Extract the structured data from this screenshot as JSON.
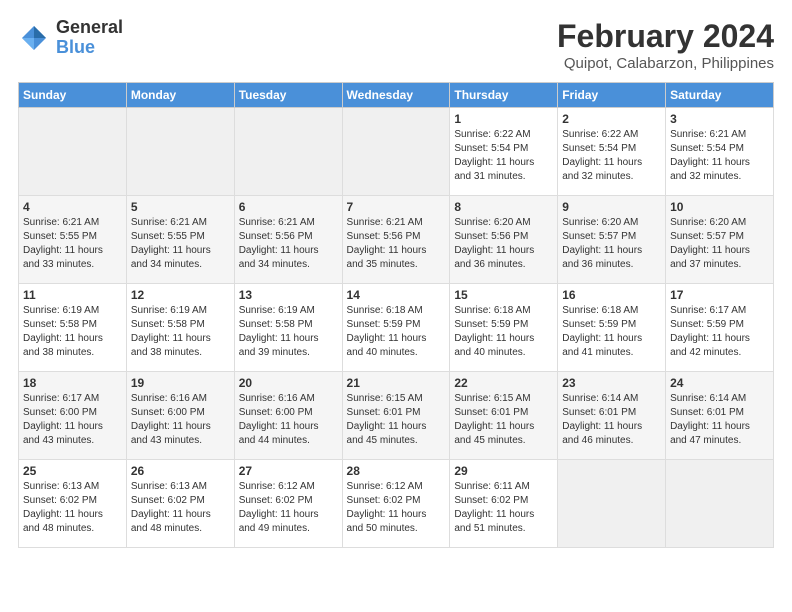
{
  "logo": {
    "general": "General",
    "blue": "Blue"
  },
  "header": {
    "title": "February 2024",
    "subtitle": "Quipot, Calabarzon, Philippines"
  },
  "days": [
    "Sunday",
    "Monday",
    "Tuesday",
    "Wednesday",
    "Thursday",
    "Friday",
    "Saturday"
  ],
  "weeks": [
    [
      {
        "day": "",
        "content": ""
      },
      {
        "day": "",
        "content": ""
      },
      {
        "day": "",
        "content": ""
      },
      {
        "day": "",
        "content": ""
      },
      {
        "day": "1",
        "content": "Sunrise: 6:22 AM\nSunset: 5:54 PM\nDaylight: 11 hours and 31 minutes."
      },
      {
        "day": "2",
        "content": "Sunrise: 6:22 AM\nSunset: 5:54 PM\nDaylight: 11 hours and 32 minutes."
      },
      {
        "day": "3",
        "content": "Sunrise: 6:21 AM\nSunset: 5:54 PM\nDaylight: 11 hours and 32 minutes."
      }
    ],
    [
      {
        "day": "4",
        "content": "Sunrise: 6:21 AM\nSunset: 5:55 PM\nDaylight: 11 hours and 33 minutes."
      },
      {
        "day": "5",
        "content": "Sunrise: 6:21 AM\nSunset: 5:55 PM\nDaylight: 11 hours and 34 minutes."
      },
      {
        "day": "6",
        "content": "Sunrise: 6:21 AM\nSunset: 5:56 PM\nDaylight: 11 hours and 34 minutes."
      },
      {
        "day": "7",
        "content": "Sunrise: 6:21 AM\nSunset: 5:56 PM\nDaylight: 11 hours and 35 minutes."
      },
      {
        "day": "8",
        "content": "Sunrise: 6:20 AM\nSunset: 5:56 PM\nDaylight: 11 hours and 36 minutes."
      },
      {
        "day": "9",
        "content": "Sunrise: 6:20 AM\nSunset: 5:57 PM\nDaylight: 11 hours and 36 minutes."
      },
      {
        "day": "10",
        "content": "Sunrise: 6:20 AM\nSunset: 5:57 PM\nDaylight: 11 hours and 37 minutes."
      }
    ],
    [
      {
        "day": "11",
        "content": "Sunrise: 6:19 AM\nSunset: 5:58 PM\nDaylight: 11 hours and 38 minutes."
      },
      {
        "day": "12",
        "content": "Sunrise: 6:19 AM\nSunset: 5:58 PM\nDaylight: 11 hours and 38 minutes."
      },
      {
        "day": "13",
        "content": "Sunrise: 6:19 AM\nSunset: 5:58 PM\nDaylight: 11 hours and 39 minutes."
      },
      {
        "day": "14",
        "content": "Sunrise: 6:18 AM\nSunset: 5:59 PM\nDaylight: 11 hours and 40 minutes."
      },
      {
        "day": "15",
        "content": "Sunrise: 6:18 AM\nSunset: 5:59 PM\nDaylight: 11 hours and 40 minutes."
      },
      {
        "day": "16",
        "content": "Sunrise: 6:18 AM\nSunset: 5:59 PM\nDaylight: 11 hours and 41 minutes."
      },
      {
        "day": "17",
        "content": "Sunrise: 6:17 AM\nSunset: 5:59 PM\nDaylight: 11 hours and 42 minutes."
      }
    ],
    [
      {
        "day": "18",
        "content": "Sunrise: 6:17 AM\nSunset: 6:00 PM\nDaylight: 11 hours and 43 minutes."
      },
      {
        "day": "19",
        "content": "Sunrise: 6:16 AM\nSunset: 6:00 PM\nDaylight: 11 hours and 43 minutes."
      },
      {
        "day": "20",
        "content": "Sunrise: 6:16 AM\nSunset: 6:00 PM\nDaylight: 11 hours and 44 minutes."
      },
      {
        "day": "21",
        "content": "Sunrise: 6:15 AM\nSunset: 6:01 PM\nDaylight: 11 hours and 45 minutes."
      },
      {
        "day": "22",
        "content": "Sunrise: 6:15 AM\nSunset: 6:01 PM\nDaylight: 11 hours and 45 minutes."
      },
      {
        "day": "23",
        "content": "Sunrise: 6:14 AM\nSunset: 6:01 PM\nDaylight: 11 hours and 46 minutes."
      },
      {
        "day": "24",
        "content": "Sunrise: 6:14 AM\nSunset: 6:01 PM\nDaylight: 11 hours and 47 minutes."
      }
    ],
    [
      {
        "day": "25",
        "content": "Sunrise: 6:13 AM\nSunset: 6:02 PM\nDaylight: 11 hours and 48 minutes."
      },
      {
        "day": "26",
        "content": "Sunrise: 6:13 AM\nSunset: 6:02 PM\nDaylight: 11 hours and 48 minutes."
      },
      {
        "day": "27",
        "content": "Sunrise: 6:12 AM\nSunset: 6:02 PM\nDaylight: 11 hours and 49 minutes."
      },
      {
        "day": "28",
        "content": "Sunrise: 6:12 AM\nSunset: 6:02 PM\nDaylight: 11 hours and 50 minutes."
      },
      {
        "day": "29",
        "content": "Sunrise: 6:11 AM\nSunset: 6:02 PM\nDaylight: 11 hours and 51 minutes."
      },
      {
        "day": "",
        "content": ""
      },
      {
        "day": "",
        "content": ""
      }
    ]
  ]
}
